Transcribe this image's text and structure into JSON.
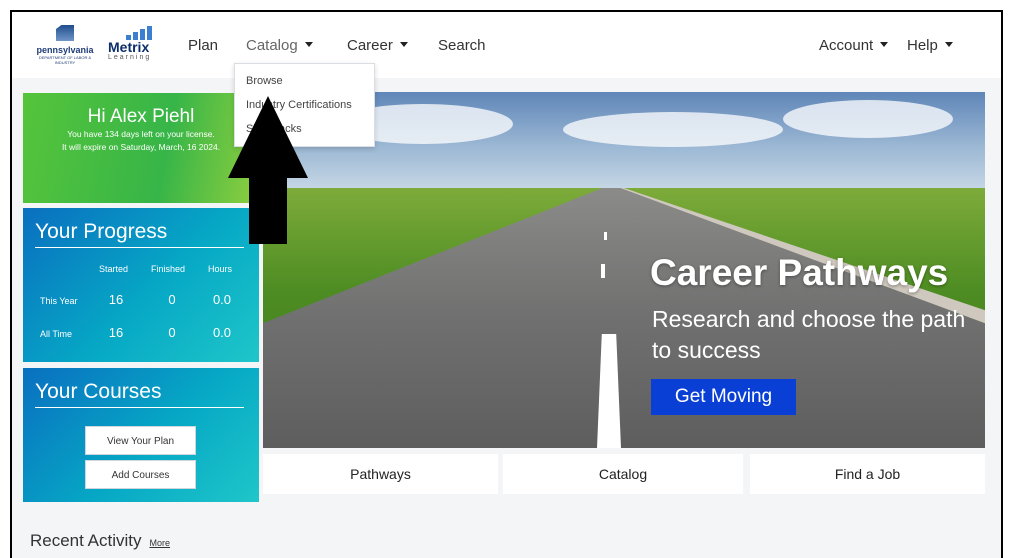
{
  "nav": {
    "brand_pa": "pennsylvania",
    "brand_pa_sub": "DEPARTMENT OF LABOR & INDUSTRY",
    "brand_metrix": "Metrix",
    "brand_learning": "Learning",
    "plan": "Plan",
    "catalog": "Catalog",
    "career": "Career",
    "search": "Search",
    "account": "Account",
    "help": "Help"
  },
  "catalog_menu": {
    "browse": "Browse",
    "certifications": "Industry Certifications",
    "skill_tracks": "Skill Tracks"
  },
  "welcome": {
    "greeting": "Hi Alex Piehl",
    "line1": "You have 134 days left on your license.",
    "line2": "It will expire on Saturday, March, 16 2024."
  },
  "progress": {
    "title": "Your Progress",
    "col_started": "Started",
    "col_finished": "Finished",
    "col_hours": "Hours",
    "this_year_label": "This Year",
    "this_year_started": "16",
    "this_year_finished": "0",
    "this_year_hours": "0.0",
    "all_time_label": "All Time",
    "all_time_started": "16",
    "all_time_finished": "0",
    "all_time_hours": "0.0"
  },
  "courses": {
    "title": "Your Courses",
    "view_plan": "View Your Plan",
    "add_courses": "Add Courses"
  },
  "hero": {
    "title": "Career Pathways",
    "subtitle": "Research and choose the path to success",
    "button": "Get Moving"
  },
  "tiles": {
    "pathways": "Pathways",
    "catalog": "Catalog",
    "find_job": "Find a Job"
  },
  "recent": {
    "title": "Recent Activity",
    "more": "More"
  },
  "colors": {
    "green": "#37b548",
    "blue_panel": "#0a6fc0",
    "hero_button": "#0a3fd6"
  }
}
